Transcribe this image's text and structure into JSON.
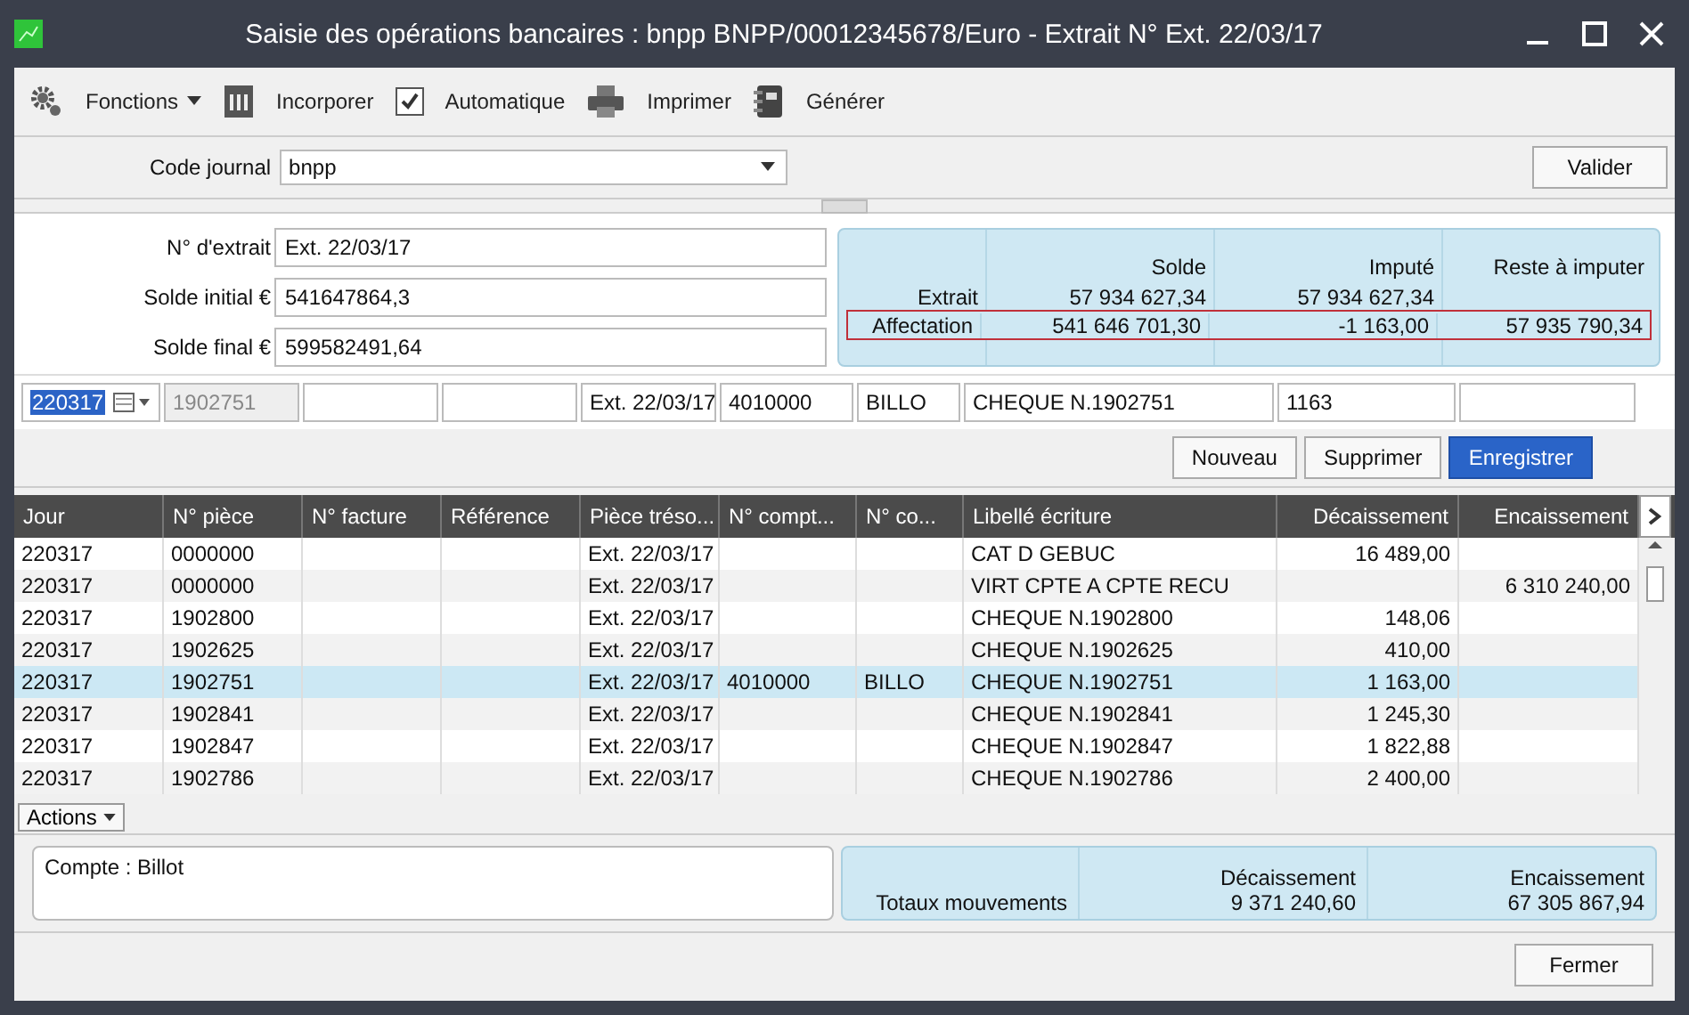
{
  "window": {
    "title": "Saisie des opérations bancaires : bnpp BNPP/00012345678/Euro - Extrait N° Ext. 22/03/17"
  },
  "toolbar": [
    {
      "label": "Fonctions",
      "kind": "menu"
    },
    {
      "label": "Incorporer",
      "kind": "button"
    },
    {
      "label": "Automatique",
      "kind": "toggle",
      "checked": true
    },
    {
      "label": "Imprimer",
      "kind": "button"
    },
    {
      "label": "Générer",
      "kind": "button"
    }
  ],
  "journal": {
    "label": "Code journal",
    "value": "bnpp",
    "button": "Valider"
  },
  "extract_fields": [
    {
      "label": "N° d'extrait",
      "value": "Ext. 22/03/17"
    },
    {
      "label": "Solde initial €",
      "value": "541647864,3"
    },
    {
      "label": "Solde final €",
      "value": "599582491,64"
    }
  ],
  "summary": {
    "columns": [
      "Solde",
      "Imputé",
      "Reste à imputer"
    ],
    "rows": [
      {
        "label": "Extrait",
        "values": [
          "57 934 627,34",
          "57 934 627,34"
        ],
        "highlighted": false
      },
      {
        "label": "Affectation",
        "values": [
          "541 646 701,30",
          "-1 163,00",
          "57 935 790,34"
        ],
        "highlighted": true
      }
    ]
  },
  "entry": [
    {
      "kind": "date",
      "value": "220317"
    },
    {
      "kind": "field",
      "value": "1902751",
      "disabled": true
    },
    {
      "kind": "field",
      "disabled": false
    },
    {
      "kind": "field",
      "disabled": false
    },
    {
      "kind": "field",
      "value": "Ext. 22/03/17",
      "disabled": false
    },
    {
      "kind": "field",
      "value": "4010000",
      "disabled": false
    },
    {
      "kind": "field",
      "value": "BILLO",
      "disabled": false
    },
    {
      "kind": "field",
      "value": "CHEQUE N.1902751",
      "disabled": false
    },
    {
      "kind": "field",
      "value": "1163",
      "disabled": false
    },
    {
      "kind": "field",
      "disabled": false
    }
  ],
  "buttons": [
    {
      "label": "Nouveau",
      "primary": false
    },
    {
      "label": "Supprimer",
      "primary": false
    },
    {
      "label": "Enregistrer",
      "primary": true
    }
  ],
  "table": {
    "columns": [
      {
        "label": "Jour",
        "kind": "text"
      },
      {
        "label": "N° pièce",
        "kind": "text"
      },
      {
        "label": "N° facture",
        "kind": "text"
      },
      {
        "label": "Référence",
        "kind": "text"
      },
      {
        "label": "Pièce tréso...",
        "kind": "text"
      },
      {
        "label": "N° compt...",
        "kind": "text"
      },
      {
        "label": "N° co...",
        "kind": "text"
      },
      {
        "label": "Libellé écriture",
        "kind": "text"
      },
      {
        "label": "Décaissement",
        "kind": "amount"
      },
      {
        "label": "Encaissement",
        "kind": "amount"
      }
    ],
    "rows": [
      {
        "cells": [
          "220317",
          "0000000",
          "",
          "",
          "Ext. 22/03/17",
          "",
          "",
          "CAT D GEBUC",
          "16 489,00",
          ""
        ],
        "selected": false
      },
      {
        "cells": [
          "220317",
          "0000000",
          "",
          "",
          "Ext. 22/03/17",
          "",
          "",
          "VIRT CPTE A CPTE RECU",
          "",
          "6 310 240,00"
        ],
        "selected": false
      },
      {
        "cells": [
          "220317",
          "1902800",
          "",
          "",
          "Ext. 22/03/17",
          "",
          "",
          "CHEQUE N.1902800",
          "148,06",
          ""
        ],
        "selected": false
      },
      {
        "cells": [
          "220317",
          "1902625",
          "",
          "",
          "Ext. 22/03/17",
          "",
          "",
          "CHEQUE N.1902625",
          "410,00",
          ""
        ],
        "selected": false
      },
      {
        "cells": [
          "220317",
          "1902751",
          "",
          "",
          "Ext. 22/03/17",
          "4010000",
          "BILLO",
          "CHEQUE N.1902751",
          "1 163,00",
          ""
        ],
        "selected": true
      },
      {
        "cells": [
          "220317",
          "1902841",
          "",
          "",
          "Ext. 22/03/17",
          "",
          "",
          "CHEQUE N.1902841",
          "1 245,30",
          ""
        ],
        "selected": false
      },
      {
        "cells": [
          "220317",
          "1902847",
          "",
          "",
          "Ext. 22/03/17",
          "",
          "",
          "CHEQUE N.1902847",
          "1 822,88",
          ""
        ],
        "selected": false
      },
      {
        "cells": [
          "220317",
          "1902786",
          "",
          "",
          "Ext. 22/03/17",
          "",
          "",
          "CHEQUE N.1902786",
          "2 400,00",
          ""
        ],
        "selected": false
      }
    ]
  },
  "actions": {
    "label": "Actions"
  },
  "account": {
    "text": "Compte : Billot"
  },
  "totals": {
    "label": "Totaux mouvements",
    "columns": [
      {
        "heading": "Décaissement",
        "value": "9 371 240,60"
      },
      {
        "heading": "Encaissement",
        "value": "67 305 867,94"
      }
    ]
  },
  "footer": {
    "button": "Fermer"
  }
}
